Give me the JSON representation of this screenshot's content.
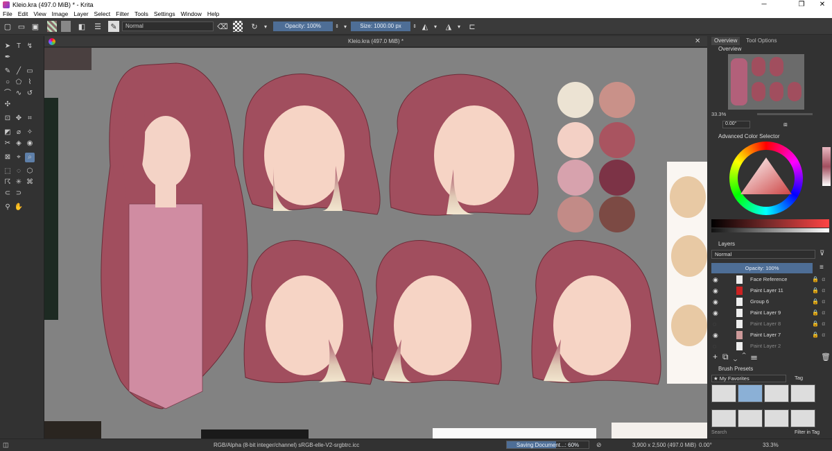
{
  "window": {
    "title": "Kleio.kra (497.0 MiB) * - Krita",
    "minimize": "─",
    "maximize": "❐",
    "close": "✕"
  },
  "menu": [
    "File",
    "Edit",
    "View",
    "Image",
    "Layer",
    "Select",
    "Filter",
    "Tools",
    "Settings",
    "Window",
    "Help"
  ],
  "toolbar": {
    "blend_mode": "Normal",
    "opacity": "Opacity: 100%",
    "size": "Size: 1000.00 px"
  },
  "document": {
    "tab_title": "Kleio.kra (497.0 MiB) *",
    "close": "✕"
  },
  "palette_colors": [
    "#ece3d3",
    "#c99189",
    "#f3d0c5",
    "#a95460",
    "#d7a2ad",
    "#7c3346",
    "#c28b87",
    "#7c4a44"
  ],
  "dock": {
    "tabs": [
      "Overview",
      "Tool Options"
    ],
    "overview_title": "Overview",
    "zoom": "33.3%",
    "rotation": "0.00°",
    "color_selector_title": "Advanced Color Selector",
    "layers_title": "Layers",
    "layer_blend": "Normal",
    "layer_opacity": "Opacity: 100%",
    "layers": [
      {
        "name": "Face Reference",
        "visible": true
      },
      {
        "name": "Paint Layer 11",
        "visible": true
      },
      {
        "name": "Group 6",
        "visible": true
      },
      {
        "name": "Paint Layer 9",
        "visible": true
      },
      {
        "name": "Paint Layer 8",
        "visible": false
      },
      {
        "name": "Paint Layer 7",
        "visible": true
      },
      {
        "name": "Paint Layer 2",
        "visible": false
      }
    ],
    "brush_presets_title": "Brush Presets",
    "brush_tag_label": "★ My Favorites",
    "brush_tag_button": "Tag",
    "search_placeholder": "Search",
    "filter_in_tag": "Filter in Tag"
  },
  "status": {
    "color_space": "RGB/Alpha (8-bit integer/channel)  sRGB-elle-V2-srgbtrc.icc",
    "saving": "Saving Document...: 60%",
    "saving_progress": 0.6,
    "dimensions": "3,900 x 2,500 (497.0 MiB)",
    "rotation": "0.00°",
    "zoom": "33.3%"
  }
}
